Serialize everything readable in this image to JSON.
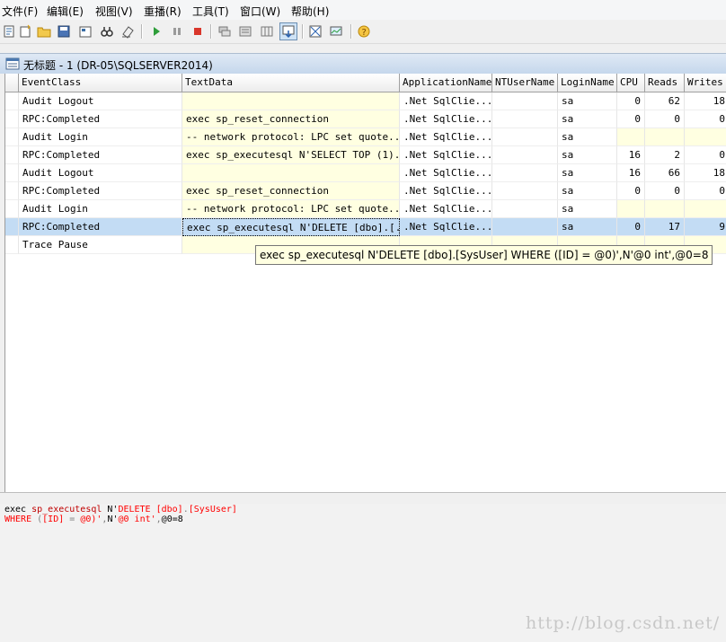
{
  "menu": [
    "文件(F)",
    "编辑(E)",
    "视图(V)",
    "重播(R)",
    "工具(T)",
    "窗口(W)",
    "帮助(H)"
  ],
  "toolbar": {
    "icons": [
      "new-trace-icon",
      "new-template-icon",
      "open-icon",
      "save-icon",
      "properties-icon",
      "find-icon",
      "clear-icon",
      "run-icon",
      "pause-icon",
      "stop-icon",
      "group-icon",
      "aggregate-icon",
      "columns-icon",
      "autoscroll-icon",
      "chart-icon",
      "monitor-icon",
      "help-icon"
    ]
  },
  "window": {
    "title": "无标题 - 1 (DR-05\\SQLSERVER2014)"
  },
  "grid": {
    "columns": [
      "EventClass",
      "TextData",
      "ApplicationName",
      "NTUserName",
      "LoginName",
      "CPU",
      "Reads",
      "Writes"
    ],
    "rows": [
      {
        "event": "Audit Logout",
        "text": "",
        "app": ".Net SqlClie...",
        "nt": "",
        "login": "sa",
        "cpu": "0",
        "reads": "62",
        "writes": "18"
      },
      {
        "event": "RPC:Completed",
        "text": "exec sp_reset_connection",
        "app": ".Net SqlClie...",
        "nt": "",
        "login": "sa",
        "cpu": "0",
        "reads": "0",
        "writes": "0"
      },
      {
        "event": "Audit Login",
        "text": "-- network protocol: LPC  set quote...",
        "app": ".Net SqlClie...",
        "nt": "",
        "login": "sa",
        "cpu": "",
        "reads": "",
        "writes": ""
      },
      {
        "event": "RPC:Completed",
        "text": "exec sp_executesql N'SELECT TOP (1)...",
        "app": ".Net SqlClie...",
        "nt": "",
        "login": "sa",
        "cpu": "16",
        "reads": "2",
        "writes": "0"
      },
      {
        "event": "Audit Logout",
        "text": "",
        "app": ".Net SqlClie...",
        "nt": "",
        "login": "sa",
        "cpu": "16",
        "reads": "66",
        "writes": "18"
      },
      {
        "event": "RPC:Completed",
        "text": "exec sp_reset_connection",
        "app": ".Net SqlClie...",
        "nt": "",
        "login": "sa",
        "cpu": "0",
        "reads": "0",
        "writes": "0"
      },
      {
        "event": "Audit Login",
        "text": "-- network protocol: LPC  set quote...",
        "app": ".Net SqlClie...",
        "nt": "",
        "login": "sa",
        "cpu": "",
        "reads": "",
        "writes": ""
      },
      {
        "event": "RPC:Completed",
        "text": "exec sp_executesql N'DELETE [dbo].[...",
        "app": ".Net SqlClie...",
        "nt": "",
        "login": "sa",
        "cpu": "0",
        "reads": "17",
        "writes": "9",
        "selected": true
      },
      {
        "event": "Trace Pause",
        "text": "",
        "app": "",
        "nt": "",
        "login": "",
        "cpu": "",
        "reads": "",
        "writes": ""
      }
    ]
  },
  "tooltip": "exec sp_executesql N'DELETE [dbo].[SysUser]  WHERE ([ID] = @0)',N'@0 int',@0=8",
  "detail": {
    "line1": [
      {
        "t": "exec ",
        "c": "#000000"
      },
      {
        "t": "sp_executesql",
        "c": "#c00000"
      },
      {
        "t": " N'",
        "c": "#000000"
      },
      {
        "t": "DELETE",
        "c": "#ff0000"
      },
      {
        "t": " [dbo]",
        "c": "#ff0000"
      },
      {
        "t": ".",
        "c": "#808080"
      },
      {
        "t": "[SysUser]",
        "c": "#ff0000"
      }
    ],
    "line2": [
      {
        "t": "WHERE ",
        "c": "#ff0000"
      },
      {
        "t": "(",
        "c": "#808080"
      },
      {
        "t": "[ID] ",
        "c": "#ff0000"
      },
      {
        "t": "= ",
        "c": "#808080"
      },
      {
        "t": "@0",
        "c": "#ff0000"
      },
      {
        "t": ")'",
        "c": "#ff0000"
      },
      {
        "t": ",",
        "c": "#808080"
      },
      {
        "t": "N'",
        "c": "#000000"
      },
      {
        "t": "@0 int'",
        "c": "#ff0000"
      },
      {
        "t": ",",
        "c": "#808080"
      },
      {
        "t": "@0=8",
        "c": "#000000"
      }
    ]
  },
  "watermark": "http://blog.csdn.net/",
  "colors": {
    "selected_row": "#c3dcf4",
    "text_cell_bg": "#ffffe1",
    "title_grad_top": "#dfe9f5"
  }
}
